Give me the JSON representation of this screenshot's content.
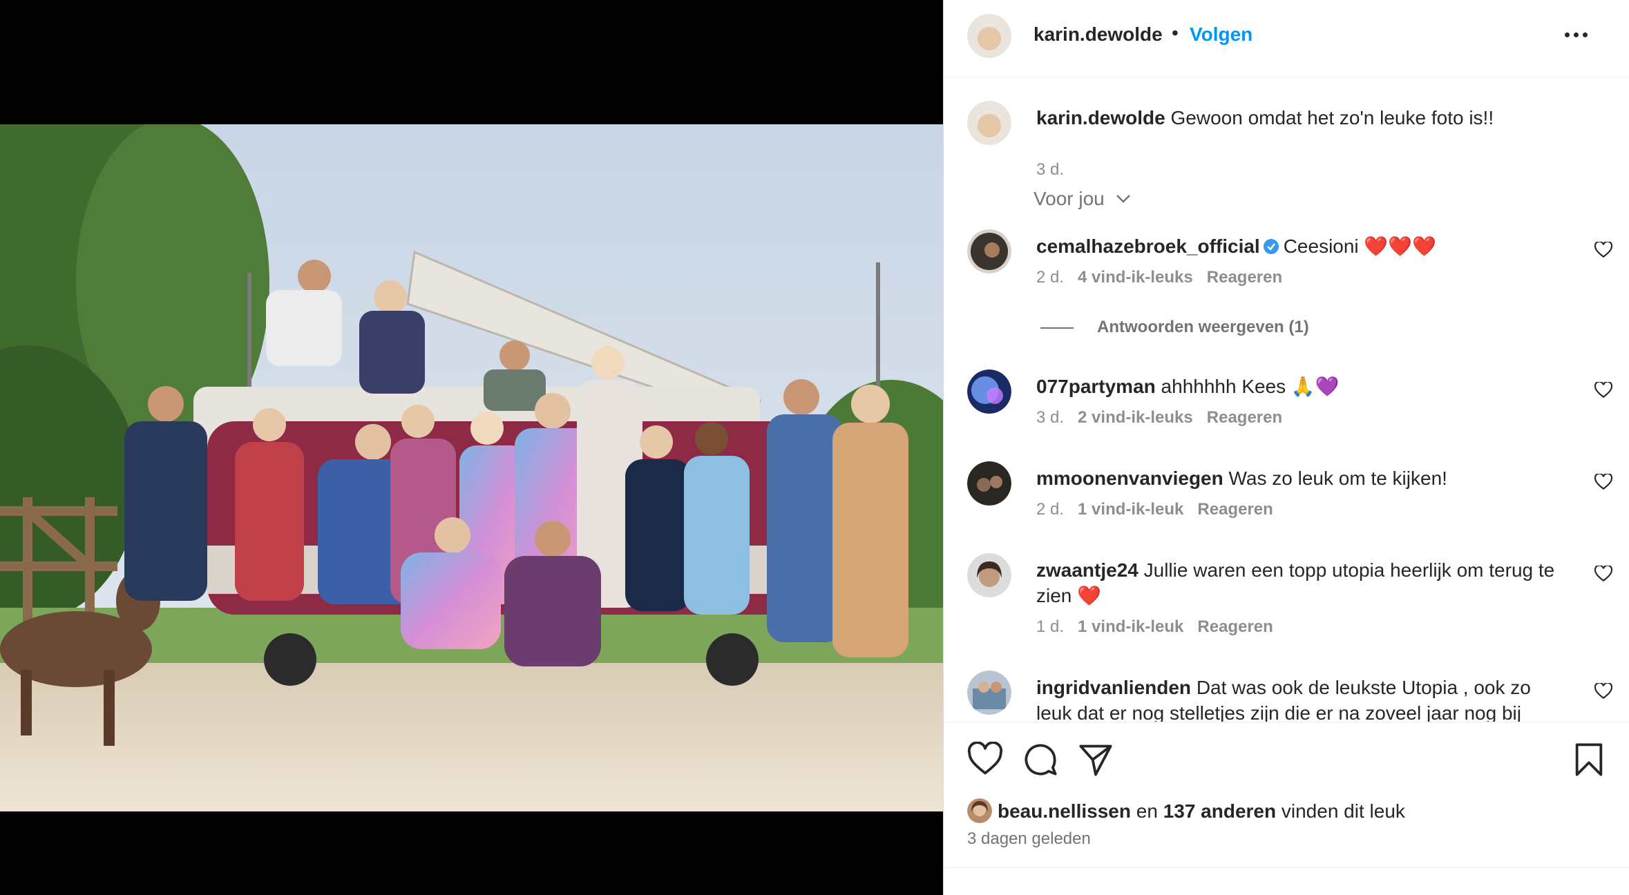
{
  "post": {
    "username": "karin.dewolde",
    "separator": "•",
    "follow_label": "Volgen"
  },
  "comments": [
    {
      "user": "karin.dewolde",
      "text": "Gewoon omdat het zo'n leuke foto is!!",
      "time": "3 d."
    },
    {
      "user": "cemalhazebroek_official",
      "text": "Ceesioni ❤️❤️❤️",
      "time": "2 d.",
      "likes": "4 vind-ik-leuks",
      "reply": "Reageren",
      "verified": true
    },
    {
      "user": "077partyman",
      "text": "ahhhhhh Kees 🙏💜",
      "time": "3 d.",
      "likes": "2 vind-ik-leuks",
      "reply": "Reageren"
    },
    {
      "user": "mmoonenvanviegen",
      "text": "Was zo leuk om te kijken!",
      "time": "2 d.",
      "likes": "1 vind-ik-leuk",
      "reply": "Reageren"
    },
    {
      "user": "zwaantje24",
      "text": "Jullie waren een topp utopia heerlijk om terug te zien ❤️",
      "time": "1 d.",
      "likes": "1 vind-ik-leuk",
      "reply": "Reageren"
    },
    {
      "user": "ingridvanlienden",
      "text": "Dat was ook de leukste Utopia , ook zo leuk dat er nog stelletjes zijn die er na zoveel jaar nog bij",
      "time": "",
      "likes": "",
      "reply": ""
    }
  ],
  "for_you_label": "Voor jou",
  "view_replies_label": "Antwoorden weergeven (1)",
  "likes_summary": {
    "user": "beau.nellissen",
    "connector": "en",
    "others": "137 anderen",
    "suffix": "vinden dit leuk"
  },
  "posted_ago": "3 dagen geleden",
  "colors": {
    "link": "#0095f6",
    "verified": "#3897f0",
    "muted": "#8e8e8e"
  }
}
